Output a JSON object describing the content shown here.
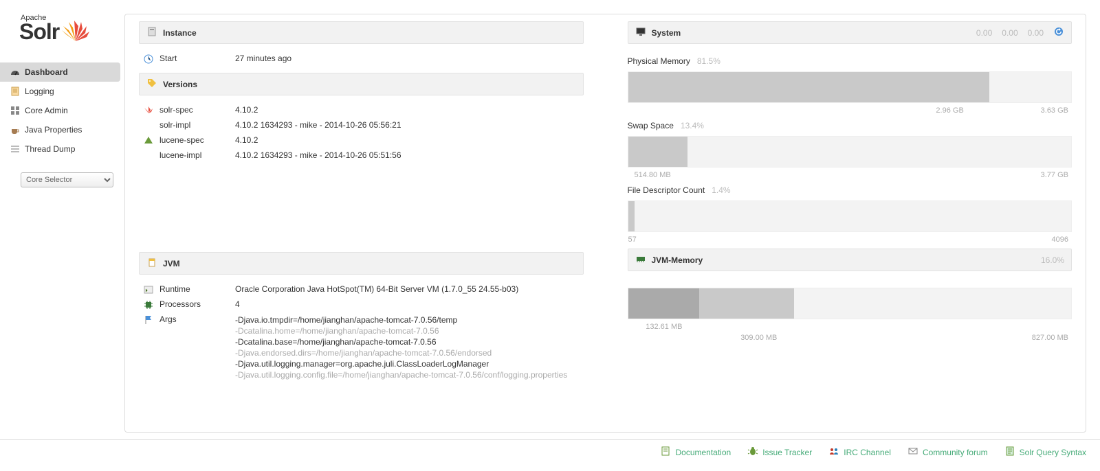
{
  "brand": {
    "apache": "Apache",
    "solr": "Solr"
  },
  "nav": {
    "dashboard": "Dashboard",
    "logging": "Logging",
    "core_admin": "Core Admin",
    "java_properties": "Java Properties",
    "thread_dump": "Thread Dump",
    "core_selector": "Core Selector"
  },
  "instance": {
    "title": "Instance",
    "start_label": "Start",
    "start_value": "27 minutes ago"
  },
  "versions": {
    "title": "Versions",
    "solr_spec_label": "solr-spec",
    "solr_spec": "4.10.2",
    "solr_impl_label": "solr-impl",
    "solr_impl": "4.10.2 1634293 - mike - 2014-10-26 05:56:21",
    "lucene_spec_label": "lucene-spec",
    "lucene_spec": "4.10.2",
    "lucene_impl_label": "lucene-impl",
    "lucene_impl": "4.10.2 1634293 - mike - 2014-10-26 05:51:56"
  },
  "jvm": {
    "title": "JVM",
    "runtime_label": "Runtime",
    "runtime": "Oracle Corporation Java HotSpot(TM) 64-Bit Server VM (1.7.0_55 24.55-b03)",
    "processors_label": "Processors",
    "processors": "4",
    "args_label": "Args",
    "args": [
      {
        "text": "-Djava.io.tmpdir=/home/jianghan/apache-tomcat-7.0.56/temp",
        "dim": false
      },
      {
        "text": "-Dcatalina.home=/home/jianghan/apache-tomcat-7.0.56",
        "dim": true
      },
      {
        "text": "-Dcatalina.base=/home/jianghan/apache-tomcat-7.0.56",
        "dim": false
      },
      {
        "text": "-Djava.endorsed.dirs=/home/jianghan/apache-tomcat-7.0.56/endorsed",
        "dim": true
      },
      {
        "text": "-Djava.util.logging.manager=org.apache.juli.ClassLoaderLogManager",
        "dim": false
      },
      {
        "text": "-Djava.util.logging.config.file=/home/jianghan/apache-tomcat-7.0.56/conf/logging.properties",
        "dim": true
      }
    ]
  },
  "system": {
    "title": "System",
    "loads": [
      "0.00",
      "0.00",
      "0.00"
    ],
    "metrics": [
      {
        "name": "Physical Memory",
        "pct": "81.5%",
        "pct_num": 81.5,
        "used": "2.96 GB",
        "total": "3.63 GB"
      },
      {
        "name": "Swap Space",
        "pct": "13.4%",
        "pct_num": 13.4,
        "used": "514.80 MB",
        "total": "3.77 GB"
      },
      {
        "name": "File Descriptor Count",
        "pct": "1.4%",
        "pct_num": 1.4,
        "used": "57",
        "total": "4096"
      }
    ]
  },
  "jvmmem": {
    "title": "JVM-Memory",
    "pct": "16.0%",
    "used": "132.61 MB",
    "used_pct": 16.0,
    "committed": "309.00 MB",
    "committed_pct": 37.4,
    "max": "827.00 MB"
  },
  "footer": {
    "documentation": "Documentation",
    "issue_tracker": "Issue Tracker",
    "irc": "IRC Channel",
    "forum": "Community forum",
    "query_syntax": "Solr Query Syntax"
  }
}
